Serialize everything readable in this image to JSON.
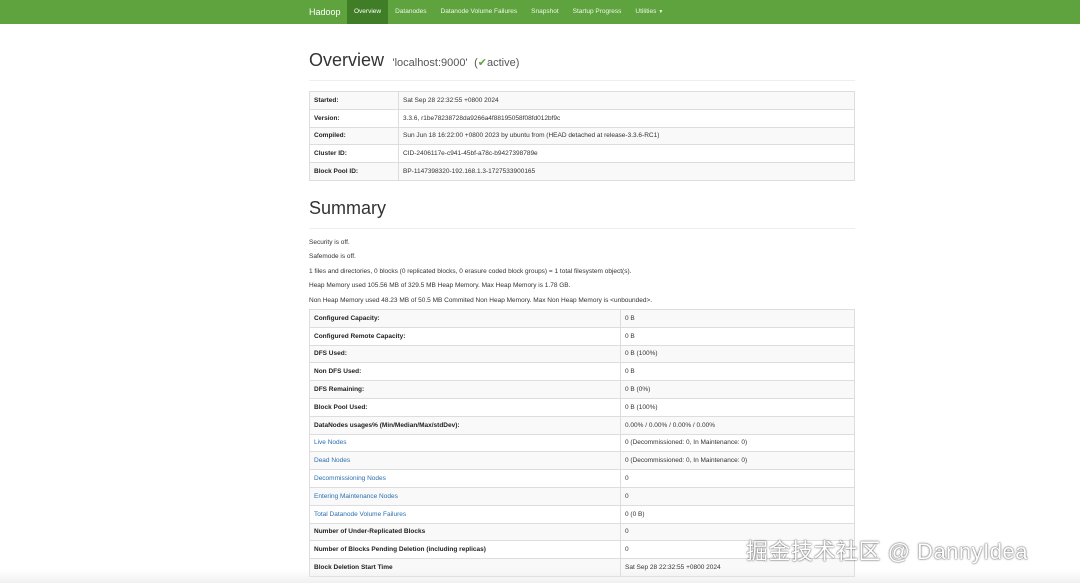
{
  "navbar": {
    "brand": "Hadoop",
    "items": [
      {
        "label": "Overview"
      },
      {
        "label": "Datanodes"
      },
      {
        "label": "Datanode Volume Failures"
      },
      {
        "label": "Snapshot"
      },
      {
        "label": "Startup Progress"
      },
      {
        "label": "Utilities"
      }
    ]
  },
  "overview": {
    "title": "Overview",
    "host": "'localhost:9000'",
    "status_open": "(",
    "status_check": "✔",
    "status": "active)",
    "rows": [
      {
        "key": "Started:",
        "value": "Sat Sep 28 22:32:55 +0800 2024"
      },
      {
        "key": "Version:",
        "value": "3.3.6, r1be78238728da9266a4f88195058f08fd012bf9c"
      },
      {
        "key": "Compiled:",
        "value": "Sun Jun 18 16:22:00 +0800 2023 by ubuntu from (HEAD detached at release-3.3.6-RC1)"
      },
      {
        "key": "Cluster ID:",
        "value": "CID-2406117e-c941-45bf-a78c-b9427398789e"
      },
      {
        "key": "Block Pool ID:",
        "value": "BP-1147398320-192.168.1.3-1727533900165"
      }
    ]
  },
  "summary": {
    "title": "Summary",
    "lines": [
      "Security is off.",
      "Safemode is off.",
      "1 files and directories, 0 blocks (0 replicated blocks, 0 erasure coded block groups) = 1 total filesystem object(s).",
      "Heap Memory used 105.56 MB of 329.5 MB Heap Memory. Max Heap Memory is 1.78 GB.",
      "Non Heap Memory used 48.23 MB of 50.5 MB Commited Non Heap Memory. Max Non Heap Memory is <unbounded>."
    ],
    "rows": [
      {
        "key": "Configured Capacity:",
        "value": "0 B"
      },
      {
        "key": "Configured Remote Capacity:",
        "value": "0 B"
      },
      {
        "key": "DFS Used:",
        "value": "0 B (100%)"
      },
      {
        "key": "Non DFS Used:",
        "value": "0 B"
      },
      {
        "key": "DFS Remaining:",
        "value": "0 B (0%)"
      },
      {
        "key": "Block Pool Used:",
        "value": "0 B (100%)"
      },
      {
        "key": "DataNodes usages% (Min/Median/Max/stdDev):",
        "value": "0.00% / 0.00% / 0.00% / 0.00%"
      },
      {
        "key": "Live Nodes",
        "value": "0 (Decommissioned: 0, In Maintenance: 0)"
      },
      {
        "key": "Dead Nodes",
        "value": "0 (Decommissioned: 0, In Maintenance: 0)"
      },
      {
        "key": "Decommissioning Nodes",
        "value": "0"
      },
      {
        "key": "Entering Maintenance Nodes",
        "value": "0"
      },
      {
        "key": "Total Datanode Volume Failures",
        "value": "0 (0 B)"
      },
      {
        "key": "Number of Under-Replicated Blocks",
        "value": "0"
      },
      {
        "key": "Number of Blocks Pending Deletion (including replicas)",
        "value": "0"
      },
      {
        "key": "Block Deletion Start Time",
        "value": "Sat Sep 28 22:32:55 +0800 2024"
      }
    ]
  },
  "watermark": "掘金技术社区 @ DannyIdea",
  "colors": {
    "navbar": "#5fa33e",
    "nav_active": "#3f7d26",
    "link": "#2a6fb0"
  }
}
